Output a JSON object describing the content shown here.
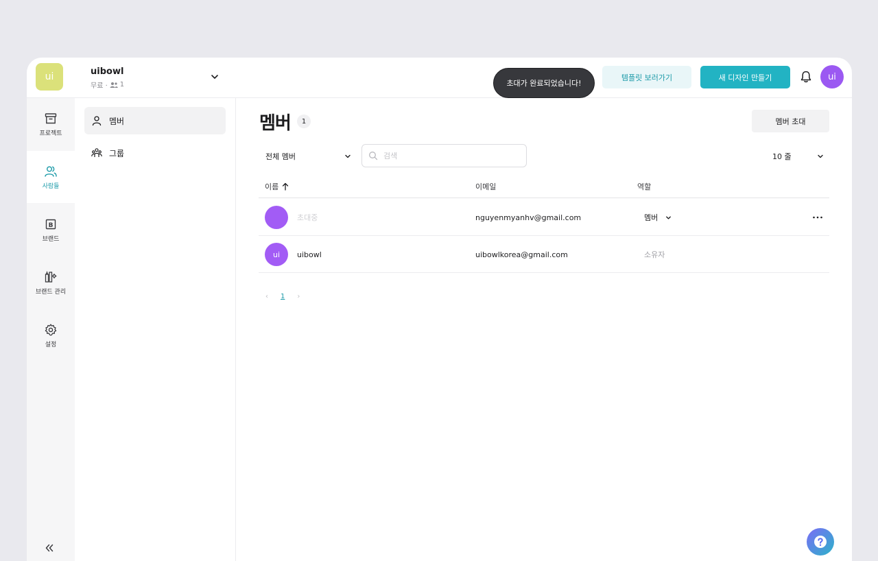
{
  "workspace": {
    "logo_text": "ui",
    "name": "uibowl",
    "plan": "무료 ·",
    "member_count": "1"
  },
  "toast": {
    "message": "초대가 완료되었습니다!"
  },
  "header": {
    "template_button": "템플릿 보러가기",
    "new_design_button": "새 디자인 만들기",
    "avatar_initials": "ui"
  },
  "nav": {
    "items": [
      {
        "label": "프로젝트",
        "icon": "archive-box-icon"
      },
      {
        "label": "사람들",
        "icon": "users-icon",
        "active": true
      },
      {
        "label": "브랜드",
        "icon": "brand-b-icon"
      },
      {
        "label": "브랜드 관리",
        "icon": "brand-manage-icon"
      },
      {
        "label": "설정",
        "icon": "gear-icon"
      }
    ],
    "collapse_icon": "chevrons-left-icon"
  },
  "subnav": {
    "items": [
      {
        "label": "멤버",
        "icon": "person-icon",
        "active": true
      },
      {
        "label": "그룹",
        "icon": "group-icon"
      }
    ]
  },
  "main": {
    "title": "멤버",
    "count": "1",
    "invite_button": "멤버 초대",
    "filter_value": "전체 멤버",
    "search_placeholder": "검색",
    "rows_per_page": "10 줄",
    "columns": {
      "name": "이름",
      "email": "이메일",
      "role": "역할"
    },
    "members": [
      {
        "avatar": "",
        "name": "초대중",
        "email": "nguyenmyanhv@gmail.com",
        "role": "멤버",
        "pending": true
      },
      {
        "avatar": "ui",
        "name": "uibowl",
        "email": "uibowlkorea@gmail.com",
        "role": "소유자",
        "pending": false
      }
    ],
    "pagination": {
      "prev": "‹",
      "current": "1",
      "next": "›"
    }
  },
  "colors": {
    "accent": "#22b3c3",
    "avatar": "#a25cf5",
    "logo": "#dbe17a",
    "toast": "#37383c"
  }
}
